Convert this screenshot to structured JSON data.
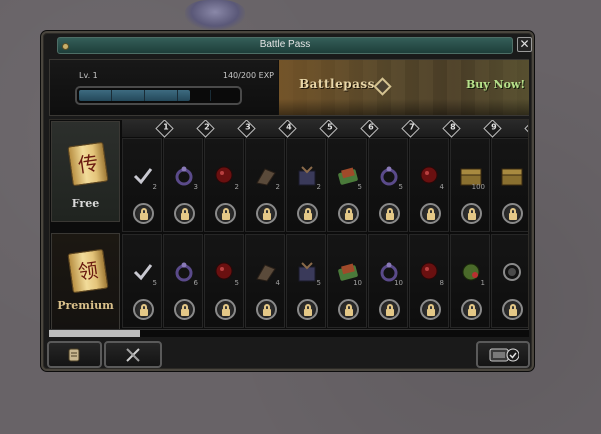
{
  "window": {
    "title": "Battle Pass"
  },
  "header": {
    "level_label": "Lv. 1",
    "exp_label": "140/200 EXP",
    "exp_fraction": 0.7,
    "banner_label": "Battlepass",
    "buy_label": "Buy Now!"
  },
  "tracks": {
    "free_label": "Free",
    "premium_label": "Premium",
    "free_glyph": "传",
    "premium_glyph": "领"
  },
  "levels": [
    "1",
    "2",
    "3",
    "4",
    "5",
    "6",
    "7",
    "8",
    "9"
  ],
  "free_rewards": [
    {
      "icon": "checkmark-icon",
      "count": "2",
      "color": "#6a6a7a"
    },
    {
      "icon": "ring-icon",
      "count": "3",
      "color": "#5a4a8a"
    },
    {
      "icon": "red-orb-icon",
      "count": "2",
      "color": "#6a1010"
    },
    {
      "icon": "feather-icon",
      "count": "2",
      "color": "#5a4a3a"
    },
    {
      "icon": "book-icon",
      "count": "2",
      "color": "#3a3a5a"
    },
    {
      "icon": "green-scroll-icon",
      "count": "5",
      "color": "#4a7a3a"
    },
    {
      "icon": "ring-icon",
      "count": "5",
      "color": "#5a4a8a"
    },
    {
      "icon": "red-orb-icon",
      "count": "4",
      "color": "#6a1010"
    },
    {
      "icon": "treasure-chest-icon",
      "count": "100",
      "color": "#8a7030"
    },
    {
      "icon": "treasure-chest-icon",
      "count": "",
      "color": "#8a7030"
    }
  ],
  "premium_rewards": [
    {
      "icon": "checkmark-icon",
      "count": "5",
      "color": "#6a6a7a"
    },
    {
      "icon": "ring-icon",
      "count": "6",
      "color": "#5a4a8a"
    },
    {
      "icon": "red-orb-icon",
      "count": "5",
      "color": "#6a1010"
    },
    {
      "icon": "feather-icon",
      "count": "4",
      "color": "#5a4a3a"
    },
    {
      "icon": "book-icon",
      "count": "5",
      "color": "#3a3a5a"
    },
    {
      "icon": "green-scroll-icon",
      "count": "10",
      "color": "#4a7a3a"
    },
    {
      "icon": "ring-icon",
      "count": "10",
      "color": "#5a4a8a"
    },
    {
      "icon": "red-orb-icon",
      "count": "8",
      "color": "#6a1010"
    },
    {
      "icon": "green-gem-icon",
      "count": "1",
      "color": "#4a6a2a"
    },
    {
      "icon": "chain-orb-icon",
      "count": "",
      "color": "#4a4a4a"
    }
  ],
  "scroll_position": 0.19,
  "footer": {
    "left_icon": "scroll-tab-icon",
    "mid_icon": "crossed-swords-icon",
    "right_icon": "claim-all-icon"
  }
}
